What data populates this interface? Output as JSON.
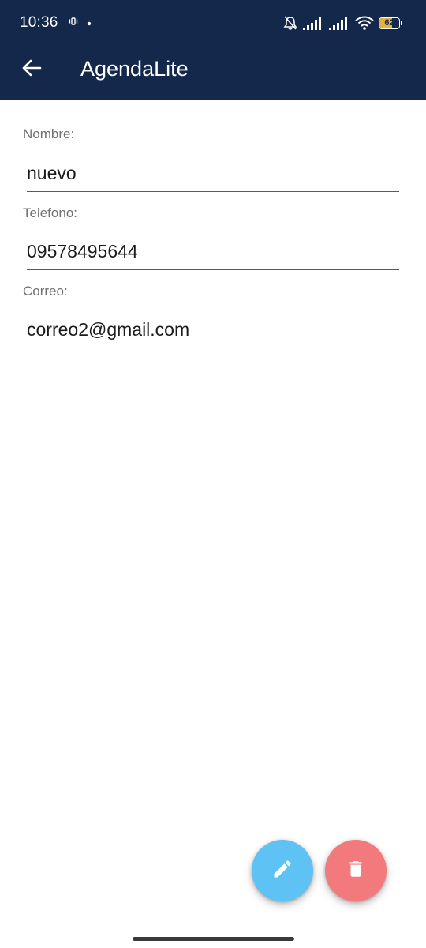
{
  "status_bar": {
    "time": "10:36",
    "battery_level": "62",
    "battery_fraction": 0.62,
    "icons": [
      "vibrate-icon",
      "notification-dot-icon",
      "alarm-off-icon",
      "signal-icon",
      "signal-icon",
      "wifi-icon",
      "battery-icon"
    ]
  },
  "app_bar": {
    "title": "AgendaLite",
    "back_icon": "arrow-left-icon",
    "background_color": "#14284b"
  },
  "form": {
    "fields": [
      {
        "label": "Nombre:",
        "value": "nuevo"
      },
      {
        "label": "Telefono:",
        "value": "09578495644"
      },
      {
        "label": "Correo:",
        "value": "correo2@gmail.com"
      }
    ]
  },
  "actions": {
    "edit": {
      "icon": "pencil-icon",
      "color": "#5fc2f5"
    },
    "delete": {
      "icon": "trash-icon",
      "color": "#f27a7c"
    }
  }
}
